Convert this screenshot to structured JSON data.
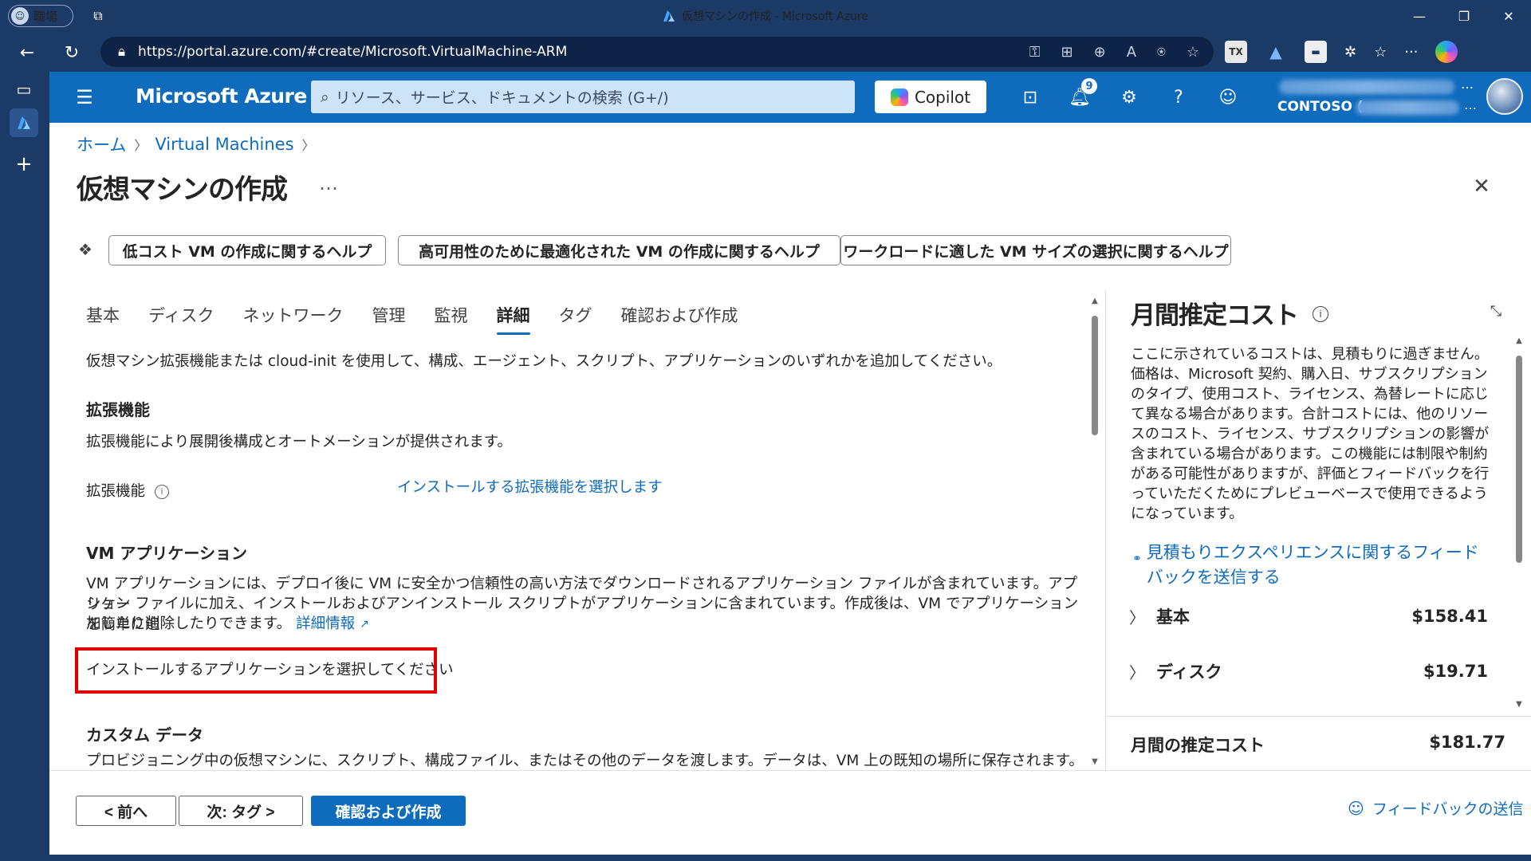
{
  "browser": {
    "profile_label": "職場",
    "window_title": "仮想マシンの作成 - Microsoft Azure",
    "url": "https://portal.azure.com/#create/Microsoft.VirtualMachine-ARM",
    "ext_badge": "TX"
  },
  "header": {
    "brand": "Microsoft Azure",
    "search_placeholder": "リソース、サービス、ドキュメントの検索 (G+/)",
    "copilot_label": "Copilot",
    "notification_count": "9",
    "account_name": "CONTOSO (",
    "account_more": "…"
  },
  "page": {
    "breadcrumb": [
      "ホーム",
      "Virtual Machines"
    ],
    "title": "仮想マシンの作成",
    "more": "…",
    "help_chips": [
      "低コスト VM の作成に関するヘルプ",
      "高可用性のために最適化された VM の作成に関するヘルプ",
      "ワークロードに適した VM サイズの選択に関するヘルプ"
    ],
    "tabs": [
      "基本",
      "ディスク",
      "ネットワーク",
      "管理",
      "監視",
      "詳細",
      "タグ",
      "確認および作成"
    ],
    "selected_tab": "詳細"
  },
  "content": {
    "intro": "仮想マシン拡張機能または cloud-init を使用して、構成、エージェント、スクリプト、アプリケーションのいずれかを追加してください。",
    "extensions_heading": "拡張機能",
    "extensions_desc": "拡張機能により展開後構成とオートメーションが提供されます。",
    "extensions_label": "拡張機能",
    "extensions_link": "インストールする拡張機能を選択します",
    "vmapps_heading": "VM アプリケーション",
    "vmapps_desc_1": "VM アプリケーションには、デプロイ後に VM に安全かつ信頼性の高い方法でダウンロードされるアプリケーション ファイルが含まれています。アプリケー",
    "vmapps_desc_2": "ション ファイルに加え、インストールおよびアンインストール スクリプトがアプリケーションに含まれています。作成後は、VM でアプリケーションを簡単に追",
    "vmapps_desc_3": "加したり削除したりできます。",
    "vmapps_more_link": "詳細情報",
    "vmapps_select_link": "インストールするアプリケーションを選択してください",
    "custom_heading": "カスタム データ",
    "custom_desc": "プロビジョニング中の仮想マシンに、スクリプト、構成ファイル、またはその他のデータを渡します。データは、VM 上の既知の場所に保存されます。"
  },
  "cost": {
    "title": "月間推定コスト",
    "desc": "ここに示されているコストは、見積もりに過ぎません。価格は、Microsoft 契約、購入日、サブスクリプションのタイプ、使用コスト、ライセンス、為替レートに応じて異なる場合があります。合計コストには、他のリソースのコスト、ライセンス、サブスクリプションの影響が含まれている場合があります。この機能には制限や制約がある可能性がありますが、評価とフィードバックを行っていただくためにプレビューベースで使用できるようになっています。",
    "feedback_link": "見積もりエクスペリエンスに関するフィードバックを送信する",
    "rows": [
      {
        "label": "基本",
        "amount": "$158.41"
      },
      {
        "label": "ディスク",
        "amount": "$19.71"
      }
    ],
    "total_label": "月間の推定コスト",
    "total_amount": "$181.77"
  },
  "footer": {
    "prev": "< 前へ",
    "next": "次: タグ >",
    "create": "確認および作成",
    "feedback": "フィードバックの送信"
  },
  "colors": {
    "accent": "#0f6cbd",
    "browser_chrome": "#1c3a66",
    "highlight_box": "#e00000"
  },
  "icons": [
    "search-icon",
    "copilot-icon",
    "cloud-shell-icon",
    "bell-icon",
    "gear-icon",
    "help-icon",
    "feedback-icon",
    "info-icon",
    "close-icon",
    "external-link-icon",
    "chevron-right-icon",
    "collapse-icon"
  ]
}
